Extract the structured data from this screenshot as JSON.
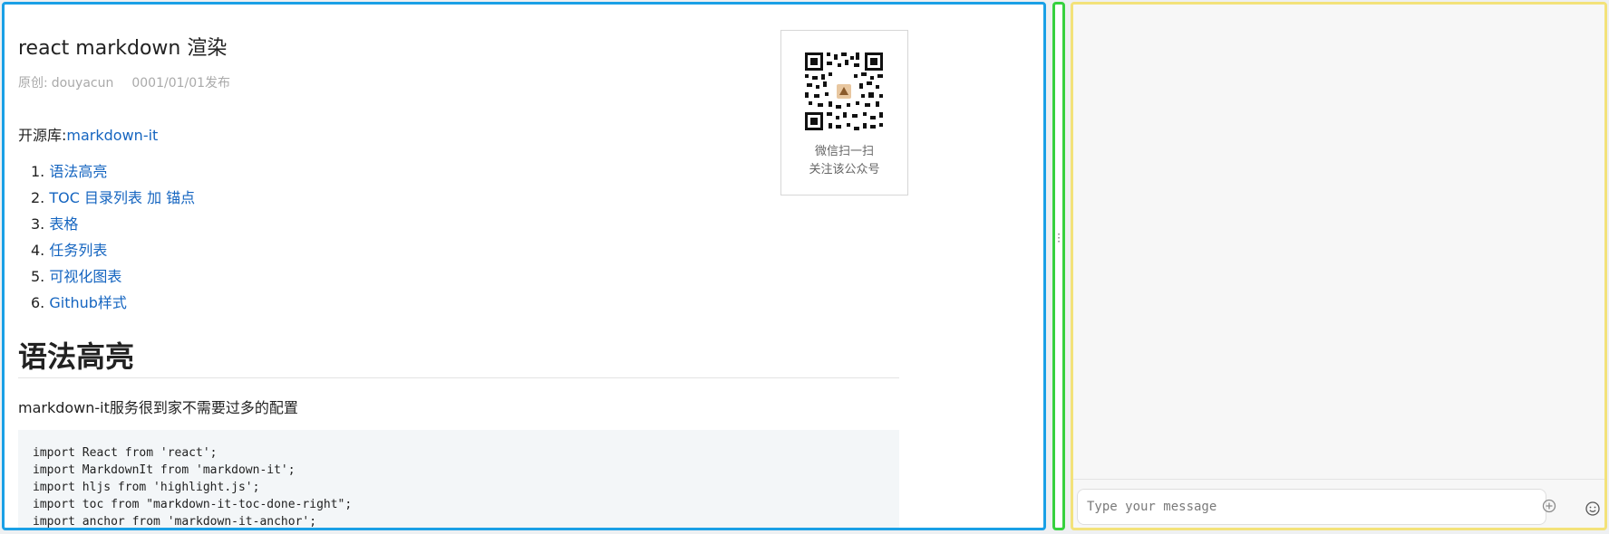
{
  "article": {
    "title": "react markdown 渲染",
    "meta": {
      "label": "原创:",
      "author": "douyacun",
      "date": "0001/01/01发布"
    },
    "library": {
      "label": "开源库:",
      "link_text": "markdown-it"
    },
    "toc": [
      {
        "num": "1.",
        "label": "语法高亮"
      },
      {
        "num": "2.",
        "label": "TOC 目录列表 加 锚点"
      },
      {
        "num": "3.",
        "label": "表格"
      },
      {
        "num": "4.",
        "label": "任务列表"
      },
      {
        "num": "5.",
        "label": "可视化图表"
      },
      {
        "num": "6.",
        "label": "Github样式"
      }
    ],
    "heading": "语法高亮",
    "paragraph": "markdown-it服务很到家不需要过多的配置",
    "code_lines": [
      "import React from 'react';",
      "import MarkdownIt from 'markdown-it';",
      "import hljs from 'highlight.js';",
      "import toc from \"markdown-it-toc-done-right\";",
      "import anchor from 'markdown-it-anchor';"
    ]
  },
  "qr": {
    "line1": "微信扫一扫",
    "line2": "关注该公众号"
  },
  "chat": {
    "placeholder": "Type your message",
    "icons": {
      "attach": "plus-circle-icon",
      "emoji": "smiley-icon"
    }
  },
  "colors": {
    "left_border": "#1aa0e6",
    "splitter_border": "#37d13f",
    "right_border": "#f3e27a",
    "link": "#1565c0"
  }
}
